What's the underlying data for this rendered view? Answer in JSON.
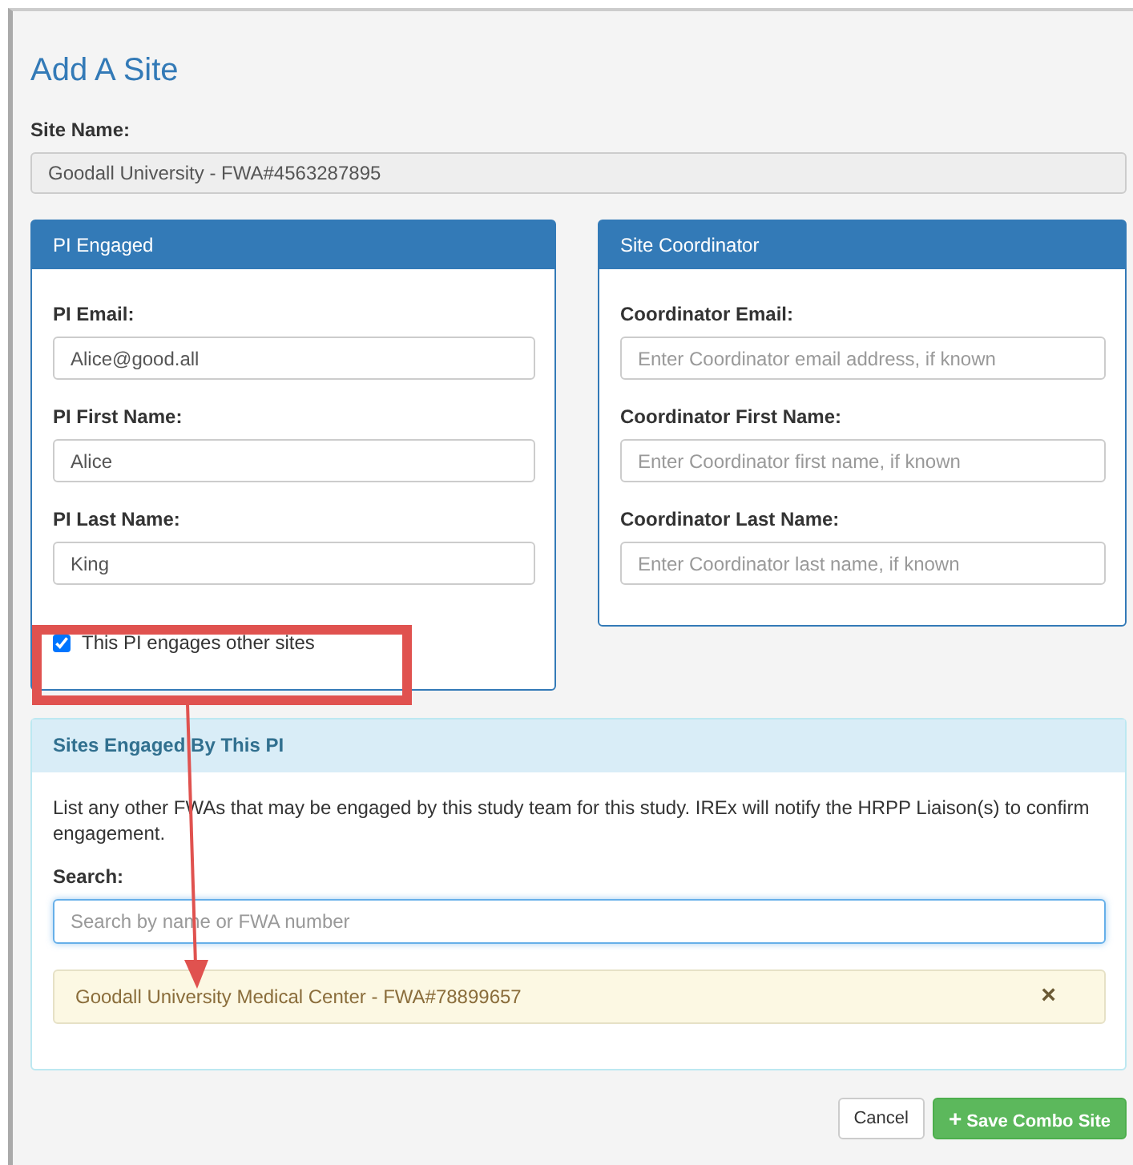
{
  "title": "Add A Site",
  "site_name": {
    "label": "Site Name:",
    "value": "Goodall University - FWA#4563287895",
    "disabled": true
  },
  "pi_panel": {
    "title": "PI Engaged",
    "fields": [
      {
        "label": "PI Email:",
        "value": "Alice@good.all"
      },
      {
        "label": "PI First Name:",
        "value": "Alice"
      },
      {
        "label": "PI Last Name:",
        "value": "King"
      }
    ],
    "other_sites": {
      "label": "This PI engages other sites",
      "checked": true
    }
  },
  "coordinator_panel": {
    "title": "Site Coordinator",
    "fields": [
      {
        "label": "Coordinator Email:",
        "placeholder": "Enter Coordinator email address, if known"
      },
      {
        "label": "Coordinator First Name:",
        "placeholder": "Enter Coordinator first name, if known"
      },
      {
        "label": "Coordinator Last Name:",
        "placeholder": "Enter Coordinator last name, if known"
      }
    ]
  },
  "sites_panel": {
    "title": "Sites Engaged By This PI",
    "description": "List any other FWAs that may be engaged by this study team for this study. IREx will notify the HRPP Liaison(s) to confirm engagement.",
    "search": {
      "label": "Search:",
      "placeholder": "Search by name or FWA number"
    },
    "selected_sites": [
      {
        "name": "Goodall University Medical Center - FWA#78899657",
        "remove": "×"
      }
    ]
  },
  "buttons": [
    {
      "label": "Cancel",
      "kind": "default"
    },
    {
      "label": "Save Combo Site",
      "kind": "primary",
      "icon": "+"
    }
  ]
}
